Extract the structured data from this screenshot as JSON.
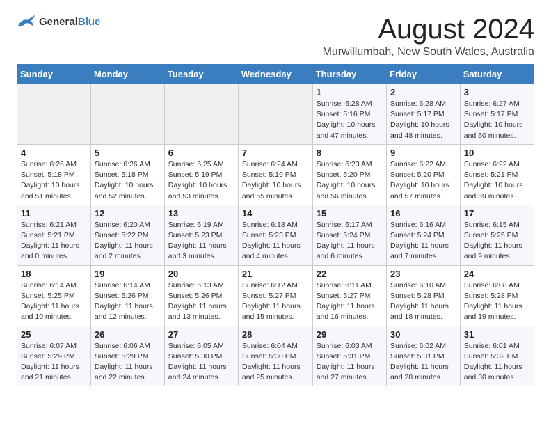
{
  "logo": {
    "general": "General",
    "blue": "Blue"
  },
  "title": {
    "month_year": "August 2024",
    "location": "Murwillumbah, New South Wales, Australia"
  },
  "weekdays": [
    "Sunday",
    "Monday",
    "Tuesday",
    "Wednesday",
    "Thursday",
    "Friday",
    "Saturday"
  ],
  "weeks": [
    [
      {
        "day": "",
        "content": ""
      },
      {
        "day": "",
        "content": ""
      },
      {
        "day": "",
        "content": ""
      },
      {
        "day": "",
        "content": ""
      },
      {
        "day": "1",
        "content": "Sunrise: 6:28 AM\nSunset: 5:16 PM\nDaylight: 10 hours\nand 47 minutes."
      },
      {
        "day": "2",
        "content": "Sunrise: 6:28 AM\nSunset: 5:17 PM\nDaylight: 10 hours\nand 48 minutes."
      },
      {
        "day": "3",
        "content": "Sunrise: 6:27 AM\nSunset: 5:17 PM\nDaylight: 10 hours\nand 50 minutes."
      }
    ],
    [
      {
        "day": "4",
        "content": "Sunrise: 6:26 AM\nSunset: 5:18 PM\nDaylight: 10 hours\nand 51 minutes."
      },
      {
        "day": "5",
        "content": "Sunrise: 6:26 AM\nSunset: 5:18 PM\nDaylight: 10 hours\nand 52 minutes."
      },
      {
        "day": "6",
        "content": "Sunrise: 6:25 AM\nSunset: 5:19 PM\nDaylight: 10 hours\nand 53 minutes."
      },
      {
        "day": "7",
        "content": "Sunrise: 6:24 AM\nSunset: 5:19 PM\nDaylight: 10 hours\nand 55 minutes."
      },
      {
        "day": "8",
        "content": "Sunrise: 6:23 AM\nSunset: 5:20 PM\nDaylight: 10 hours\nand 56 minutes."
      },
      {
        "day": "9",
        "content": "Sunrise: 6:22 AM\nSunset: 5:20 PM\nDaylight: 10 hours\nand 57 minutes."
      },
      {
        "day": "10",
        "content": "Sunrise: 6:22 AM\nSunset: 5:21 PM\nDaylight: 10 hours\nand 59 minutes."
      }
    ],
    [
      {
        "day": "11",
        "content": "Sunrise: 6:21 AM\nSunset: 5:21 PM\nDaylight: 11 hours\nand 0 minutes."
      },
      {
        "day": "12",
        "content": "Sunrise: 6:20 AM\nSunset: 5:22 PM\nDaylight: 11 hours\nand 2 minutes."
      },
      {
        "day": "13",
        "content": "Sunrise: 6:19 AM\nSunset: 5:23 PM\nDaylight: 11 hours\nand 3 minutes."
      },
      {
        "day": "14",
        "content": "Sunrise: 6:18 AM\nSunset: 5:23 PM\nDaylight: 11 hours\nand 4 minutes."
      },
      {
        "day": "15",
        "content": "Sunrise: 6:17 AM\nSunset: 5:24 PM\nDaylight: 11 hours\nand 6 minutes."
      },
      {
        "day": "16",
        "content": "Sunrise: 6:16 AM\nSunset: 5:24 PM\nDaylight: 11 hours\nand 7 minutes."
      },
      {
        "day": "17",
        "content": "Sunrise: 6:15 AM\nSunset: 5:25 PM\nDaylight: 11 hours\nand 9 minutes."
      }
    ],
    [
      {
        "day": "18",
        "content": "Sunrise: 6:14 AM\nSunset: 5:25 PM\nDaylight: 11 hours\nand 10 minutes."
      },
      {
        "day": "19",
        "content": "Sunrise: 6:14 AM\nSunset: 5:26 PM\nDaylight: 11 hours\nand 12 minutes."
      },
      {
        "day": "20",
        "content": "Sunrise: 6:13 AM\nSunset: 5:26 PM\nDaylight: 11 hours\nand 13 minutes."
      },
      {
        "day": "21",
        "content": "Sunrise: 6:12 AM\nSunset: 5:27 PM\nDaylight: 11 hours\nand 15 minutes."
      },
      {
        "day": "22",
        "content": "Sunrise: 6:11 AM\nSunset: 5:27 PM\nDaylight: 11 hours\nand 16 minutes."
      },
      {
        "day": "23",
        "content": "Sunrise: 6:10 AM\nSunset: 5:28 PM\nDaylight: 11 hours\nand 18 minutes."
      },
      {
        "day": "24",
        "content": "Sunrise: 6:08 AM\nSunset: 5:28 PM\nDaylight: 11 hours\nand 19 minutes."
      }
    ],
    [
      {
        "day": "25",
        "content": "Sunrise: 6:07 AM\nSunset: 5:29 PM\nDaylight: 11 hours\nand 21 minutes."
      },
      {
        "day": "26",
        "content": "Sunrise: 6:06 AM\nSunset: 5:29 PM\nDaylight: 11 hours\nand 22 minutes."
      },
      {
        "day": "27",
        "content": "Sunrise: 6:05 AM\nSunset: 5:30 PM\nDaylight: 11 hours\nand 24 minutes."
      },
      {
        "day": "28",
        "content": "Sunrise: 6:04 AM\nSunset: 5:30 PM\nDaylight: 11 hours\nand 25 minutes."
      },
      {
        "day": "29",
        "content": "Sunrise: 6:03 AM\nSunset: 5:31 PM\nDaylight: 11 hours\nand 27 minutes."
      },
      {
        "day": "30",
        "content": "Sunrise: 6:02 AM\nSunset: 5:31 PM\nDaylight: 11 hours\nand 28 minutes."
      },
      {
        "day": "31",
        "content": "Sunrise: 6:01 AM\nSunset: 5:32 PM\nDaylight: 11 hours\nand 30 minutes."
      }
    ]
  ]
}
